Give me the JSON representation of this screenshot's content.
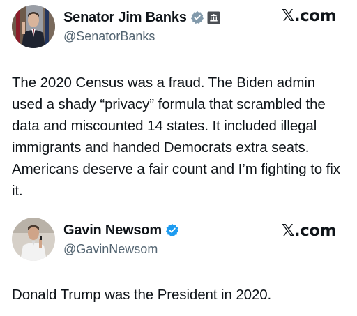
{
  "tweets": [
    {
      "author": {
        "display_name": "Senator Jim Banks",
        "handle": "@SenatorBanks",
        "verified_color": "#829aab",
        "badge": "government-building-icon"
      },
      "source": "𝕏.com",
      "text": "The 2020 Census was a fraud. The Biden admin used a shady “privacy” formula that scrambled the data and miscounted 14 states. It included illegal immigrants and handed Democrats extra seats. Americans deserve a fair count and I’m fighting to fix it."
    },
    {
      "author": {
        "display_name": "Gavin Newsom",
        "handle": "@GavinNewsom",
        "verified_color": "#1d9bf0"
      },
      "source": "𝕏.com",
      "text": "Donald Trump was the President in 2020."
    }
  ]
}
